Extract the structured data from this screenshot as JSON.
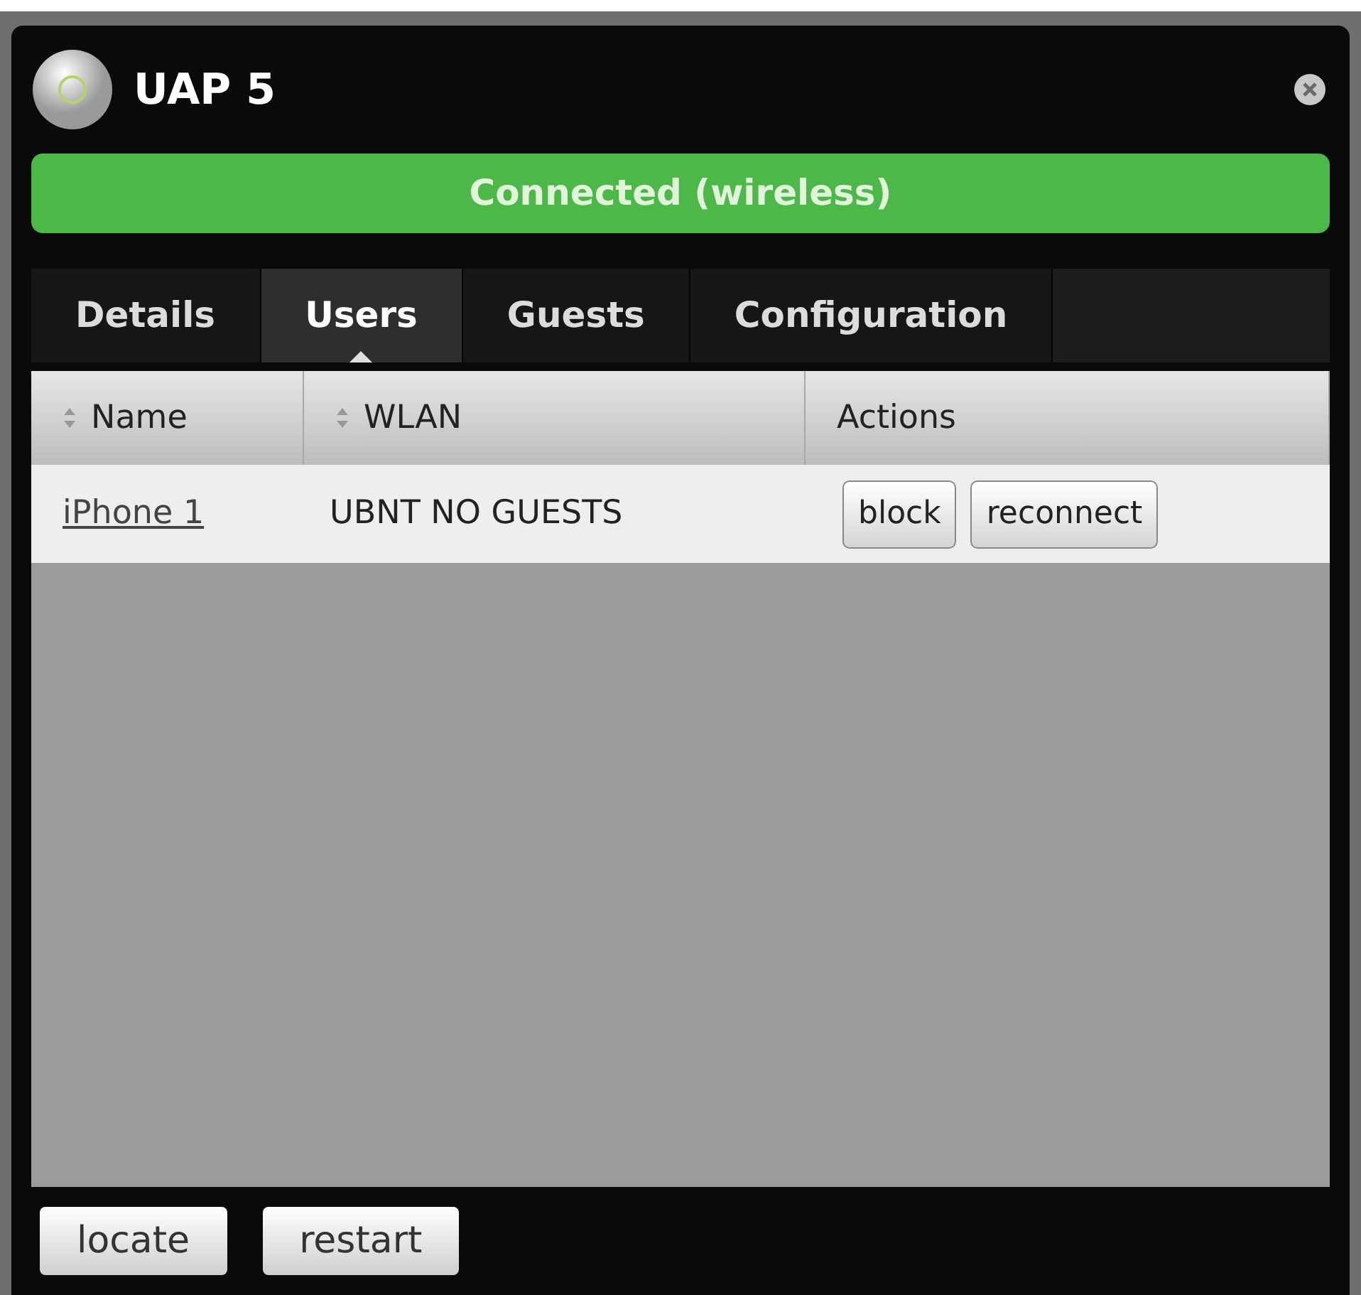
{
  "window": {
    "title": "UAP 5"
  },
  "status": {
    "label": "Connected (wireless)",
    "kind": "connected"
  },
  "tabs": [
    {
      "label": "Details",
      "selected": false
    },
    {
      "label": "Users",
      "selected": true
    },
    {
      "label": "Guests",
      "selected": false
    },
    {
      "label": "Configuration",
      "selected": false
    }
  ],
  "table": {
    "columns": [
      {
        "label": "Name",
        "sortable": true
      },
      {
        "label": "WLAN",
        "sortable": true
      },
      {
        "label": "Actions",
        "sortable": false
      }
    ],
    "rows": [
      {
        "name": "iPhone 1",
        "wlan": "UBNT NO GUESTS",
        "actions": [
          "block",
          "reconnect"
        ]
      }
    ]
  },
  "buttons": [
    "locate",
    "restart"
  ]
}
